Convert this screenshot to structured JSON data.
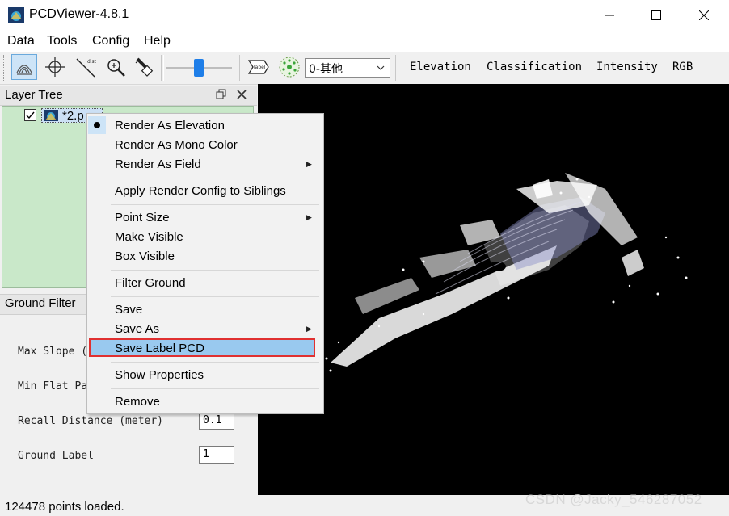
{
  "window": {
    "title": "PCDViewer-4.8.1"
  },
  "menu": [
    "Data",
    "Tools",
    "Config",
    "Help"
  ],
  "toolbar": {
    "layer_select": "0-其他",
    "render_modes": [
      "Elevation",
      "Classification",
      "Intensity",
      "RGB"
    ],
    "slider_value": 0.5,
    "measure_label": "dist",
    "tag_label": "label"
  },
  "layer_tree": {
    "title": "Layer Tree",
    "item": {
      "checked": true,
      "label": "*2.p"
    }
  },
  "ground_filter": {
    "title": "Ground Filter",
    "fields": [
      {
        "label": "Max Slope (",
        "value": ""
      },
      {
        "label": "Min Flat Pa",
        "value": ""
      },
      {
        "label": "Recall Distance (meter)",
        "value": "0.1"
      },
      {
        "label": "Ground Label",
        "value": "1"
      }
    ]
  },
  "context_menu": {
    "items": [
      "Render As Elevation",
      "Render As Mono Color",
      "Render As Field",
      "Apply Render Config to Siblings",
      "Point Size",
      "Make Visible",
      "Box Visible",
      "Filter Ground",
      "Save",
      "Save As",
      "Save Label PCD",
      "Show Properties",
      "Remove"
    ],
    "checked_item": "Render As Elevation",
    "highlighted_item": "Save Label PCD"
  },
  "status": {
    "text": "124478 points loaded."
  },
  "watermark": "CSDN @Jacky_546287052",
  "colors": {
    "highlight": "#99c9ef",
    "highlight_border": "#e03030",
    "layer_bg": "#c9e8c9",
    "viewport": "#000000"
  }
}
